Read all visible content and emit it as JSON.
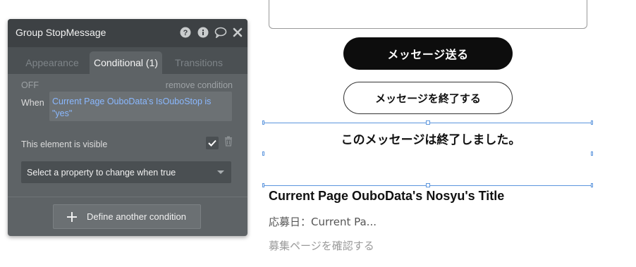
{
  "panel": {
    "title": "Group StopMessage",
    "tabs": [
      {
        "label": "Appearance",
        "active": false
      },
      {
        "label": "Conditional (1)",
        "active": true
      },
      {
        "label": "Transitions",
        "active": false
      }
    ],
    "off_label": "OFF",
    "remove_label": "remove condition",
    "when_label": "When",
    "expression": "Current Page OuboData's IsOuboStop is \"yes\"",
    "visible_label": "This element is visible",
    "visible_checked": true,
    "property_select": "Select a property to change when true",
    "define_button": "Define another condition",
    "icons": [
      "help-icon",
      "info-icon",
      "comment-icon",
      "close-icon"
    ]
  },
  "canvas": {
    "send_button": "メッセージ送る",
    "end_button": "メッセージを終了する",
    "ended_message": "このメッセージは終了しました。",
    "nosyu_title": "Current Page OuboData's Nosyu's Title",
    "apply_date": "応募日：Current Pa...",
    "confirm_link": "募集ページを確認する"
  },
  "colors": {
    "panel_bg": "#5e6366",
    "panel_header": "#3d4144",
    "expression_text": "#8ab8ff",
    "selection": "#5b95dd",
    "send_button_bg": "#0d0d0d"
  }
}
